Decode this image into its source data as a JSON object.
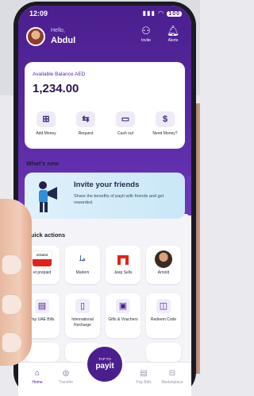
{
  "status": {
    "time": "12:09",
    "battery": "100"
  },
  "header": {
    "greeting": "Hello,",
    "user_name": "Abdul",
    "invite_label": "Invite",
    "alerts_label": "Alerts"
  },
  "balance": {
    "label": "Available Balance AED",
    "value": "1,234.00",
    "actions": [
      {
        "label": "Add Money",
        "icon": "add-money-icon"
      },
      {
        "label": "Request",
        "icon": "request-icon"
      },
      {
        "label": "Cash out",
        "icon": "cash-out-icon"
      },
      {
        "label": "Need Money?",
        "icon": "need-money-icon"
      }
    ]
  },
  "whats_new": {
    "title": "What's new",
    "banner_title": "Invite your friends",
    "banner_text": "Share the benefits of payit with friends and get rewarded."
  },
  "quick_actions": {
    "title": "Quick actions",
    "row1": [
      {
        "label": "et prepaid",
        "logo_text": "etisalat"
      },
      {
        "label": "Marlem",
        "logo_text": ""
      },
      {
        "label": "Jeep Sells",
        "logo_text": ""
      },
      {
        "label": "Arnold",
        "logo_text": ""
      }
    ],
    "row2": [
      {
        "label": "Pay UAE Bills",
        "icon": "bill-icon"
      },
      {
        "label": "International Recharge",
        "icon": "phone-icon"
      },
      {
        "label": "Gifts & Vouchers",
        "icon": "gift-icon"
      },
      {
        "label": "Redeem Code",
        "icon": "ticket-icon"
      }
    ]
  },
  "nav": {
    "home": "Home",
    "transfer": "Transfer",
    "tap_to": "TAP TO",
    "payit": "payit",
    "pay_bills": "Pay Bills",
    "marketplace": "Marketplace"
  },
  "colors": {
    "brand": "#4a1f8d",
    "accent": "#6a37b8"
  }
}
